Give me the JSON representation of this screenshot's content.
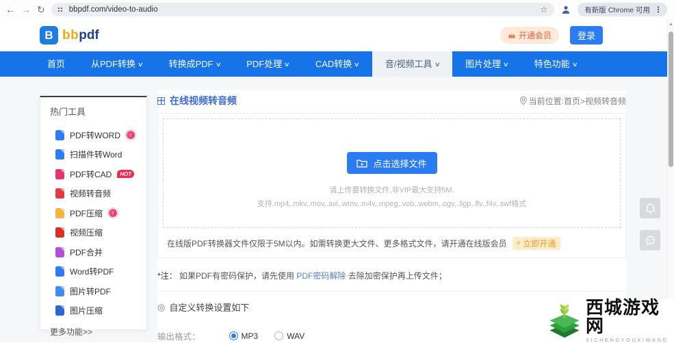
{
  "browser": {
    "url": "bbpdf.com/video-to-audio",
    "update_chip": "有新版 Chrome 可用"
  },
  "icons": {
    "back": "←",
    "forward": "→",
    "reload": "↻",
    "star": "☆",
    "menu": "⋮",
    "chevron_down": "∨",
    "up_arrow": "↑",
    "lightning": "⚡",
    "target": "◎",
    "scroll_up": "▲"
  },
  "header": {
    "logo_b": "B",
    "logo_bb": "bb",
    "logo_pdf": "pdf",
    "vip_label": "开通会员",
    "login_label": "登录"
  },
  "nav": {
    "items": [
      {
        "label": "首页",
        "active": false
      },
      {
        "label": "从PDF转换",
        "active": false
      },
      {
        "label": "转换成PDF",
        "active": false
      },
      {
        "label": "PDF处理",
        "active": false
      },
      {
        "label": "CAD转换",
        "active": false
      },
      {
        "label": "音/视频工具",
        "active": true
      },
      {
        "label": "图片处理",
        "active": false
      },
      {
        "label": "特色功能",
        "active": false
      }
    ]
  },
  "sidebar": {
    "title": "热门工具",
    "items": [
      {
        "label": "PDF转WORD",
        "color": "#2f7bf3",
        "badge": "up"
      },
      {
        "label": "扫描件转Word",
        "color": "#2f7bf3",
        "badge": ""
      },
      {
        "label": "PDF转CAD",
        "color": "#e8336d",
        "badge": "HOT"
      },
      {
        "label": "视频转音频",
        "color": "#e23c3c",
        "badge": ""
      },
      {
        "label": "PDF压缩",
        "color": "#f5b63f",
        "badge": "up"
      },
      {
        "label": "视频压缩",
        "color": "#d93025",
        "badge": ""
      },
      {
        "label": "PDF合并",
        "color": "#b44fd8",
        "badge": ""
      },
      {
        "label": "Word转PDF",
        "color": "#2f7bf3",
        "badge": ""
      },
      {
        "label": "图片转PDF",
        "color": "#3f8cf3",
        "badge": ""
      },
      {
        "label": "图片压缩",
        "color": "#2f66d0",
        "badge": ""
      }
    ],
    "more_label": "更多功能>>"
  },
  "main": {
    "page_title": "在线视频转音频",
    "breadcrumb": "当前位置:首页>视频转音频",
    "upload": {
      "button_label": "点击选择文件",
      "hint_line1": "请上传要转换文件,非VIP最大支持5M.",
      "hint_line2": "支持.mp4,.mkv,.mov,.avi,.wmv,.m4v,.mpeg,.vob,.webm,.ogv,.3gp,.flv,.f4v,.swf格式",
      "notice_text": "在线版PDF转换器文件仅限于5M以内。如需转换更大文件、更多格式文件，请开通在线版会员",
      "open_now_label": "立即开通"
    },
    "note": {
      "prefix": "*注：",
      "text_before": "如果PDF有密码保护，请先使用 ",
      "link": "PDF密码解除",
      "text_after": " 去除加密保护再上传文件；"
    },
    "settings": {
      "title": "自定义转换设置如下",
      "output_label": "输出格式：",
      "options": [
        {
          "label": "MP3",
          "checked": true
        },
        {
          "label": "WAV",
          "checked": false
        }
      ]
    }
  },
  "watermark": {
    "title": "西城游戏网",
    "subtitle": "XICHENGYOUXIWANG"
  },
  "colors": {
    "nav_blue": "#1673e8",
    "button_blue": "#2b7bf3",
    "vip_orange": "#f2603a",
    "open_now_orange": "#ef9b27",
    "watermark_green": "#2f9e3f"
  }
}
